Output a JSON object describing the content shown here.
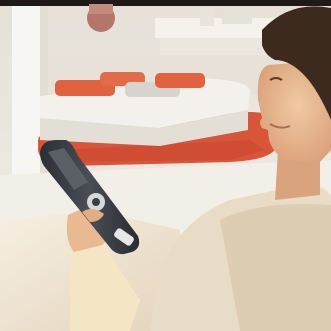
{
  "image": {
    "subject": "woman-holding-remote-control",
    "colors": {
      "wall": "#ece8e1",
      "floor": "#f2eee8",
      "rug": "#d9553a",
      "cushion": "#e0623f",
      "ottoman": "#f4f1ec",
      "sofa_fabric": "#efe2cf",
      "skin": "#e9b991",
      "hair": "#3d2a1f",
      "remote_body": "#3b3e45",
      "remote_screen": "#5b6066",
      "remote_accent": "#d7d8da",
      "sweater": "#f4e6c5",
      "dark_frame": "#1f1a17"
    }
  }
}
